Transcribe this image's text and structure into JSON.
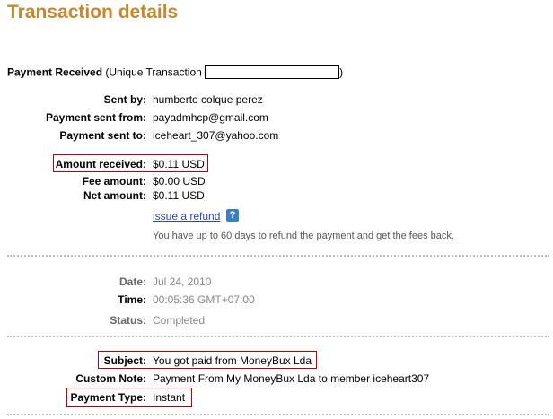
{
  "page": {
    "title": "Transaction details"
  },
  "payment_received": {
    "label": "Payment Received",
    "paren_open": " (Unique Transaction ",
    "paren_close": ")"
  },
  "details": {
    "sent_by": {
      "label": "Sent by:",
      "value": "humberto colque perez"
    },
    "sent_from": {
      "label": "Payment sent from:",
      "value": "payadmhcp@gmail.com"
    },
    "sent_to": {
      "label": "Payment sent to:",
      "value": "iceheart_307@yahoo.com"
    },
    "amount": {
      "label": "Amount received:",
      "value": "$0.11 USD"
    },
    "fee": {
      "label": "Fee amount:",
      "value": "$0.00 USD"
    },
    "net": {
      "label": "Net amount:",
      "value": "$0.11 USD"
    },
    "refund_link": "issue a refund",
    "help_icon": "?",
    "refund_note": "You have up to 60 days to refund the payment and get the fees back."
  },
  "status_section": {
    "date": {
      "label": "Date:",
      "value": "Jul 24, 2010"
    },
    "time": {
      "label": "Time:",
      "value": "00:05:36 GMT+07:00"
    },
    "status": {
      "label": "Status:",
      "value": "Completed"
    }
  },
  "note_section": {
    "subject": {
      "label": "Subject:",
      "value": "You got paid from MoneyBux Lda"
    },
    "custom_note": {
      "label": "Custom Note:",
      "value": "Payment From My MoneyBux Lda to member iceheart307"
    },
    "payment_type": {
      "label": "Payment Type:",
      "value": "Instant"
    }
  },
  "colors": {
    "title": "#c7882c",
    "highlight_box": "#c00000",
    "link": "#3344aa"
  }
}
